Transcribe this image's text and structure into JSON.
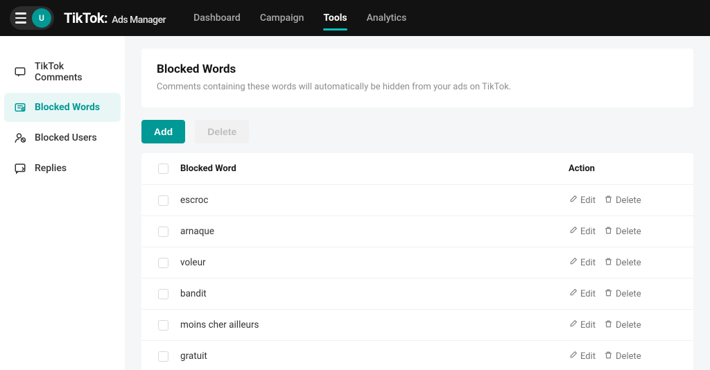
{
  "colors": {
    "accent": "#009995",
    "accent_light": "#00c4c0"
  },
  "avatar_initial": "U",
  "brand": {
    "name": "TikTok:",
    "product": "Ads Manager"
  },
  "topnav": [
    {
      "label": "Dashboard",
      "active": false
    },
    {
      "label": "Campaign",
      "active": false
    },
    {
      "label": "Tools",
      "active": true
    },
    {
      "label": "Analytics",
      "active": false
    }
  ],
  "sidebar": [
    {
      "label": "TikTok Comments",
      "icon": "comments-icon",
      "active": false
    },
    {
      "label": "Blocked Words",
      "icon": "blocked-words-icon",
      "active": true
    },
    {
      "label": "Blocked Users",
      "icon": "blocked-users-icon",
      "active": false
    },
    {
      "label": "Replies",
      "icon": "replies-icon",
      "active": false
    }
  ],
  "page": {
    "title": "Blocked Words",
    "description": "Comments containing these words will automatically be hidden from your ads on TikTok."
  },
  "buttons": {
    "add": "Add",
    "delete": "Delete"
  },
  "table": {
    "col_word": "Blocked Word",
    "col_action": "Action",
    "edit": "Edit",
    "delete": "Delete",
    "rows": [
      {
        "word": "escroc"
      },
      {
        "word": "arnaque"
      },
      {
        "word": "voleur"
      },
      {
        "word": "bandit"
      },
      {
        "word": "moins cher ailleurs"
      },
      {
        "word": "gratuit"
      }
    ]
  }
}
